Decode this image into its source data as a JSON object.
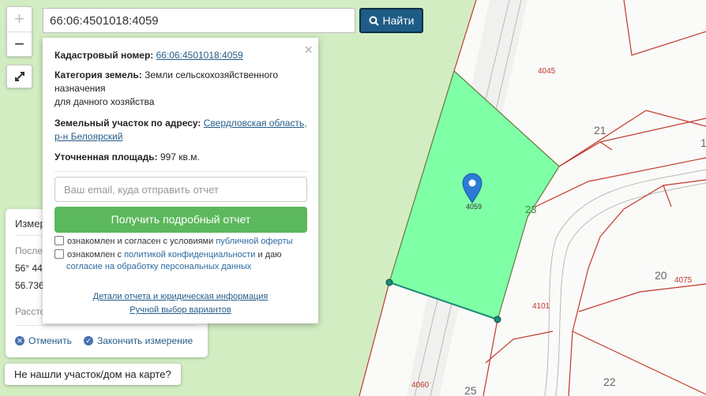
{
  "search": {
    "value": "66:06:4501018:4059",
    "find_label": "Найти"
  },
  "zoom": {
    "in": "+",
    "out": "−"
  },
  "popup": {
    "cadastral_label": "Кадастровый номер:",
    "cadastral_value": "66:06:4501018:4059",
    "category_label": "Категория земель:",
    "category_value_1": "Земли сельскохозяйственного",
    "category_value_2": "назначения",
    "category_value_3": "для дачного хозяйства",
    "address_label": "Земельный участок по адресу:",
    "address_value_1": "Свердловская область,",
    "address_value_2": "р-н Белоярский",
    "area_label": "Уточненная площадь:",
    "area_value": "997 кв.м.",
    "email_placeholder": "Ваш email, куда отправить отчет",
    "get_report": "Получить подробный отчет",
    "agree1_text": "ознакомлен и согласен с условиями",
    "agree1_link": "публичной оферты",
    "agree2_text_a": "ознакомлен с",
    "agree2_link_a": "политикой конфиденциальности",
    "agree2_text_b": "и даю",
    "agree2_link_b": "согласие на обработку персональных данных",
    "details_link": "Детали отчета и юридическая информация",
    "manual_link": "Ручной выбор вариантов",
    "close": "×"
  },
  "measure": {
    "title": "Измер",
    "last_label": "После",
    "coord1": "56° 44",
    "coord2": "56.736",
    "distance_label": "Расстo",
    "cancel": "Отменить",
    "finish": "Закончить измерение"
  },
  "not_found": "Не нашли участок/дом на карте?",
  "map_labels": {
    "l4045": "4045",
    "l21": "21",
    "l1": "1",
    "l4059": "4059",
    "l23": "23",
    "l20": "20",
    "l4075": "4075",
    "l4101": "4101",
    "l22": "22",
    "l4060": "4060",
    "l25": "25"
  },
  "colors": {
    "selected_parcel": "#7fffa6",
    "parcel_border": "#c0392b",
    "land_green": "#d3edc3",
    "find_button": "#1e5c86",
    "report_button": "#5cb85c",
    "measure_line": "#1c8a78"
  }
}
